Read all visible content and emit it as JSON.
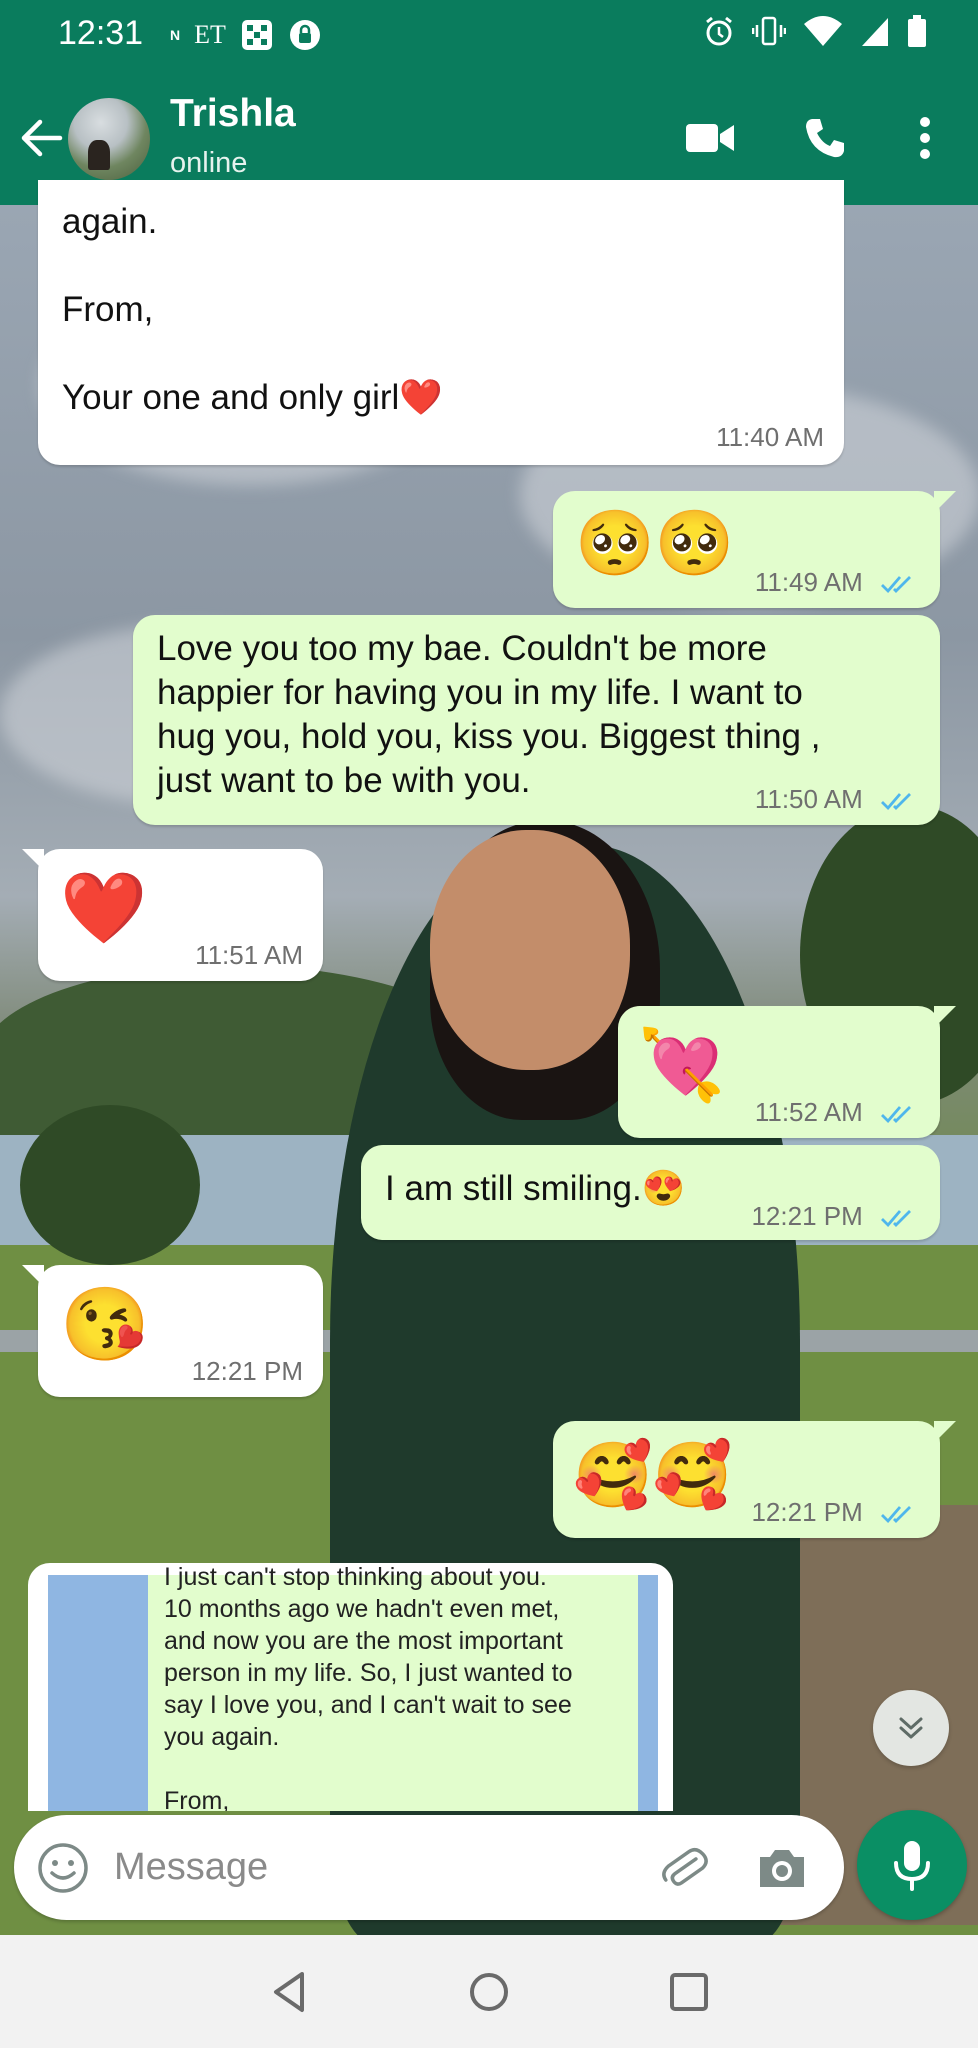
{
  "status_bar": {
    "time": "12:31",
    "left_icons": [
      "N",
      "ET"
    ],
    "right_icons": [
      "alarm-icon",
      "vibrate-icon",
      "wifi-icon",
      "signal-icon",
      "battery-icon"
    ]
  },
  "header": {
    "contact_name": "Trishla",
    "status": "online"
  },
  "colors": {
    "header_bg": "#0a7c5d",
    "incoming_bubble": "#ffffff",
    "outgoing_bubble": "#e2fdcd",
    "read_ticks": "#4fb6ec",
    "mic_button": "#0a8f64"
  },
  "messages": [
    {
      "direction": "in",
      "lines": [
        "again.",
        "",
        "From,",
        "",
        "Your one and only girl❤️"
      ],
      "time": "11:40 AM"
    },
    {
      "direction": "out",
      "emoji": "🥺🥺",
      "time": "11:49 AM",
      "read": true
    },
    {
      "direction": "out",
      "text": "Love you too my bae. Couldn't be more happier for having you in my life. I want to hug you, hold you, kiss you. Biggest thing , just want to be with you.",
      "lines": [
        "Love you too my bae. Couldn't be more",
        "happier for having you in my life. I want to",
        "hug you, hold you, kiss you. Biggest thing ,",
        "just want to be with you."
      ],
      "time": "11:50 AM",
      "read": true
    },
    {
      "direction": "in",
      "emoji": "❤️",
      "time": "11:51 AM"
    },
    {
      "direction": "out",
      "emoji": "💘",
      "time": "11:52 AM",
      "read": true
    },
    {
      "direction": "out",
      "text": "I am still smiling.😍",
      "time": "12:21 PM",
      "read": true
    },
    {
      "direction": "in",
      "emoji": "😘",
      "time": "12:21 PM"
    },
    {
      "direction": "out",
      "emoji": "🥰🥰",
      "time": "12:21 PM",
      "read": true
    }
  ],
  "image_message": {
    "lines": [
      "I just can't stop thinking about you.",
      "10 months ago we hadn't even met,",
      "and now you are the most important",
      "person in my life. So, I just wanted to",
      "say I love you, and I can't wait to see",
      "you again.",
      "",
      "From,"
    ]
  },
  "input": {
    "placeholder": "Message",
    "value": ""
  },
  "nav": [
    "back-icon",
    "home-icon",
    "recents-icon"
  ]
}
